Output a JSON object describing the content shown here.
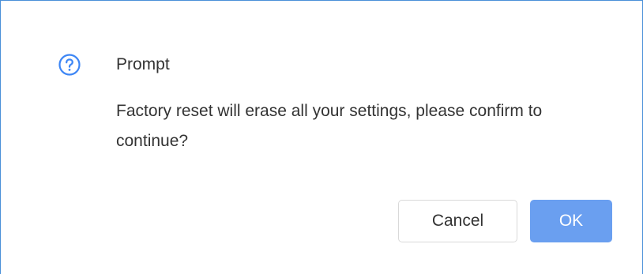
{
  "dialog": {
    "title": "Prompt",
    "icon": "question-circle-icon",
    "message": "Factory reset will erase all your settings, please confirm to continue?",
    "buttons": {
      "cancel_label": "Cancel",
      "ok_label": "OK"
    }
  },
  "colors": {
    "accent": "#4a90d9",
    "ok_button": "#6a9ff0",
    "text": "#333333",
    "cancel_border": "#d9d9d9"
  }
}
